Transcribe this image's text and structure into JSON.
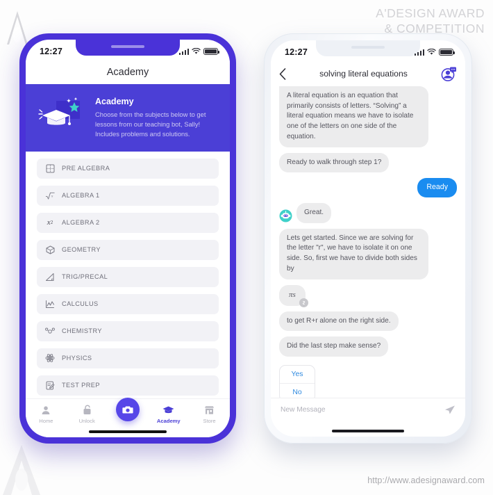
{
  "page": {
    "award_title_line1": "A'DESIGN AWARD",
    "award_title_line2": "& COMPETITION",
    "footer_url": "http://www.adesignaward.com",
    "logo_icon": "a-design-triangle-logo",
    "colors": {
      "phone_frame_purple": "#4a32d8",
      "hero_purple": "#4b3fd6",
      "accent_blue": "#1a8cf0",
      "bubble_gray": "#ececed",
      "list_row_gray": "#f2f2f6",
      "bot_teal": "#3fd0c9"
    }
  },
  "left_phone": {
    "status": {
      "clock": "12:27",
      "signal_icon": "signal-bars-icon",
      "wifi_icon": "wifi-icon",
      "battery_icon": "battery-icon"
    },
    "nav": {
      "title": "Academy"
    },
    "hero": {
      "art_icon": "graduation-cap-star-illustration",
      "title": "Academy",
      "description": "Choose from the subjects below to get lessons from our teaching bot, Sally! Includes problems and solutions."
    },
    "subjects": [
      {
        "label": "PRE ALGEBRA",
        "icon": "grid-icon"
      },
      {
        "label": "ALGEBRA 1",
        "icon": "square-root-icon"
      },
      {
        "label": "ALGEBRA 2",
        "icon": "x-squared-icon"
      },
      {
        "label": "GEOMETRY",
        "icon": "cube-icon"
      },
      {
        "label": "TRIG/PRECAL",
        "icon": "right-triangle-icon"
      },
      {
        "label": "CALCULUS",
        "icon": "line-chart-icon"
      },
      {
        "label": "CHEMISTRY",
        "icon": "molecule-icon"
      },
      {
        "label": "PHYSICS",
        "icon": "atom-icon"
      },
      {
        "label": "TEST PREP",
        "icon": "clipboard-edit-icon"
      }
    ],
    "tabs": [
      {
        "label": "Home",
        "icon": "person-icon",
        "active": false
      },
      {
        "label": "Unlock",
        "icon": "unlock-icon",
        "active": false
      },
      {
        "label": "",
        "icon": "camera-icon",
        "active": false,
        "fab": true
      },
      {
        "label": "Academy",
        "icon": "graduation-cap-icon",
        "active": true
      },
      {
        "label": "Store",
        "icon": "store-icon",
        "active": false
      }
    ]
  },
  "right_phone": {
    "status": {
      "clock": "12:27",
      "signal_icon": "signal-bars-icon",
      "wifi_icon": "wifi-icon",
      "battery_icon": "battery-icon"
    },
    "nav": {
      "back_icon": "chevron-left-icon",
      "title": "solving literal equations",
      "bot_icon": "bot-chat-avatar-icon"
    },
    "messages": [
      {
        "from": "bot",
        "text": "A literal equation is an equation that primarily consists of letters. “Solving” a literal equation means we have to isolate one of the letters on one side of the equation."
      },
      {
        "from": "bot",
        "text": "Ready to walk through step 1?"
      },
      {
        "from": "user",
        "text": "Ready"
      },
      {
        "from": "bot",
        "text": "Great.",
        "avatar": "bot-avatar-icon"
      },
      {
        "from": "bot",
        "text": "Lets get started. Since we are solving for the letter \"r\", we have to isolate it on one side. So, first we have to divide both sides by"
      },
      {
        "from": "bot",
        "text": "πs",
        "math": true,
        "badge_icon": "link-badge-icon"
      },
      {
        "from": "bot",
        "text": "to get R+r alone on the right side."
      },
      {
        "from": "bot",
        "text": "Did the last step make sense?"
      }
    ],
    "choices": [
      {
        "label": "Yes"
      },
      {
        "label": "No"
      }
    ],
    "composer": {
      "placeholder": "New Message",
      "value": "",
      "send_icon": "send-paper-plane-icon"
    }
  }
}
